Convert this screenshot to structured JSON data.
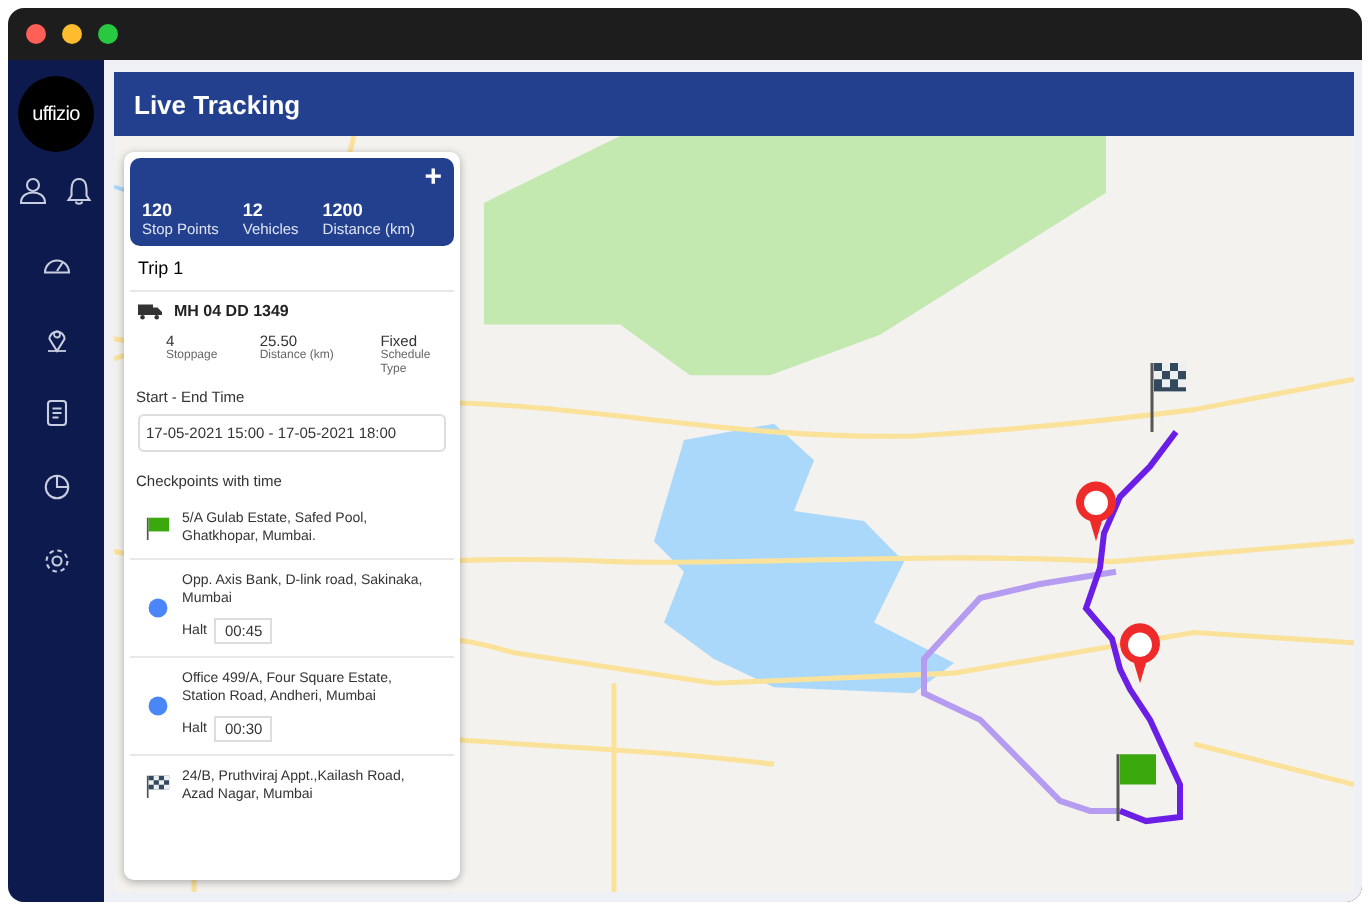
{
  "logo": {
    "text": "uffizio"
  },
  "header": {
    "title": "Live Tracking"
  },
  "summary": {
    "add_button": "+",
    "stats": [
      {
        "value": "120",
        "label": "Stop Points"
      },
      {
        "value": "12",
        "label": "Vehicles"
      },
      {
        "value": "1200",
        "label": "Distance (km)"
      }
    ]
  },
  "trip": {
    "title": "Trip 1",
    "vehicle": "MH 04 DD 1349",
    "details": [
      {
        "value": "4",
        "label": "Stoppage"
      },
      {
        "value": "25.50",
        "label": "Distance (km)"
      },
      {
        "value": "Fixed",
        "label": "Schedule Type"
      }
    ],
    "time_label": "Start - End Time",
    "time_value": "17-05-2021 15:00 - 17-05-2021 18:00"
  },
  "checkpoints": {
    "title": "Checkpoints with time",
    "items": [
      {
        "kind": "start",
        "address": "5/A Gulab Estate, Safed Pool, Ghatkhopar, Mumbai."
      },
      {
        "kind": "stop",
        "address": "Opp. Axis Bank, D-link road, Sakinaka, Mumbai",
        "halt_label": "Halt",
        "halt": "00:45"
      },
      {
        "kind": "stop",
        "address": "Office 499/A, Four Square  Estate, Station Road, Andheri, Mumbai",
        "halt_label": "Halt",
        "halt": "00:30"
      },
      {
        "kind": "end",
        "address": "24/B, Pruthviraj Appt.,Kailash Road, Azad Nagar, Mumbai"
      }
    ]
  }
}
